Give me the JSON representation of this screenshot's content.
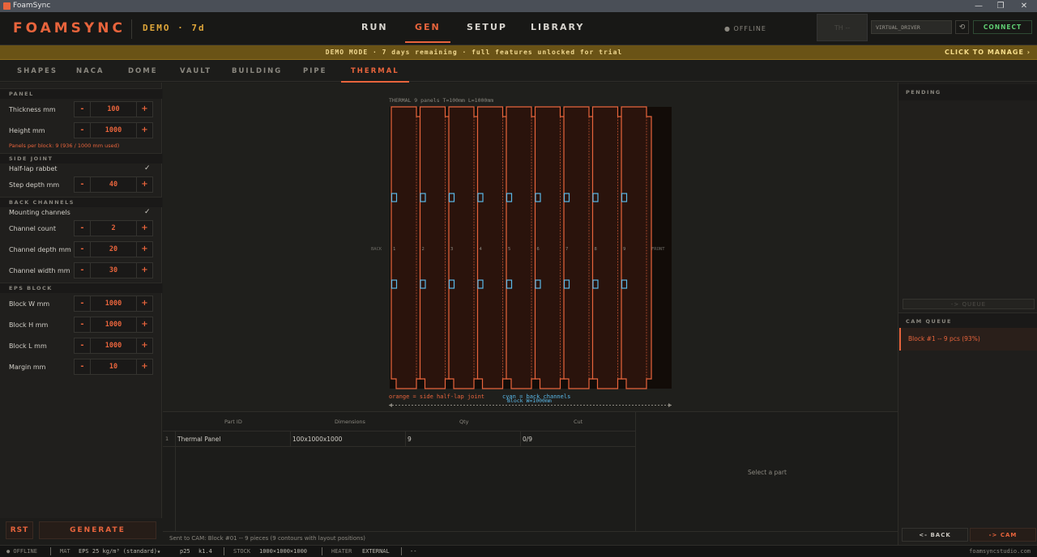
{
  "window": {
    "title": "FoamSync",
    "controls": [
      "—",
      "❐",
      "✕"
    ]
  },
  "header": {
    "brand": "FOAMSYNC",
    "demo_label": "DEMO · 7d",
    "nav": [
      "RUN",
      "GEN",
      "SETUP",
      "LIBRARY"
    ],
    "active_nav": "GEN",
    "status": "● OFFLINE",
    "driver_placeholder": "TH --",
    "driver_name": "VIRTUAL_DRIVER",
    "refresh_icon": "⟲",
    "connect_label": "CONNECT"
  },
  "banner": {
    "text": "DEMO MODE · 7 days remaining · full features unlocked for trial",
    "action": "CLICK TO MANAGE ›"
  },
  "subtabs": [
    "SHAPES",
    "NACA",
    "DOME",
    "VAULT",
    "BUILDING",
    "PIPE",
    "THERMAL"
  ],
  "active_subtab": "THERMAL",
  "left": {
    "panel": {
      "title": "PANEL",
      "thickness_label": "Thickness mm",
      "thickness": "100",
      "height_label": "Height mm",
      "height": "1000",
      "per_block": "Panels per block: 9   (936 / 1000 mm used)"
    },
    "side_joint": {
      "title": "SIDE JOINT",
      "half_lap_label": "Half-lap rabbet",
      "half_lap_checked": true,
      "step_label": "Step depth mm",
      "step": "40"
    },
    "back_channels": {
      "title": "BACK CHANNELS",
      "mounting_label": "Mounting channels",
      "mounting_checked": true,
      "count_label": "Channel count",
      "count": "2",
      "depth_label": "Channel depth mm",
      "depth": "20",
      "width_label": "Channel width mm",
      "width": "30"
    },
    "eps_block": {
      "title": "EPS BLOCK",
      "w_label": "Block W mm",
      "w": "1000",
      "h_label": "Block H mm",
      "h": "1000",
      "l_label": "Block L mm",
      "l": "1000",
      "margin_label": "Margin mm",
      "margin": "10"
    },
    "minus": "-",
    "plus": "+",
    "check": "✓",
    "rst_label": "RST",
    "generate_label": "GENERATE"
  },
  "preview": {
    "header": "THERMAL  9 panels  T=100mm  L=1000mm",
    "left_side": "BACK",
    "right_side": "FRONT",
    "panel_numbers": [
      "1",
      "2",
      "3",
      "4",
      "5",
      "6",
      "7",
      "8",
      "9"
    ],
    "panel_count": 9,
    "legend_orange": "orange = side half-lap joint",
    "legend_cyan": "cyan = back channels",
    "dim_label": "Block W=1000mm",
    "colors": {
      "orange": "#e8643c",
      "cyan": "#5ab8e8",
      "fill": "#2a130c",
      "block": "#120c08"
    }
  },
  "table": {
    "headers": [
      "Part ID",
      "Dimensions",
      "Qty",
      "Cut"
    ],
    "rows": [
      {
        "index": "1",
        "part": "Thermal Panel",
        "dims": "100x1000x1000",
        "qty": "9",
        "cut": "0/9"
      }
    ],
    "detail_placeholder": "Select a part"
  },
  "status_message": "Sent to CAM: Block #01 -- 9 pieces  (9 contours with layout positions)",
  "right": {
    "pending_title": "PENDING",
    "queue_label": "-> QUEUE",
    "cam_title": "CAM QUEUE",
    "cam_item": "Block #1 -- 9 pcs  (93%)",
    "back_label": "<- BACK",
    "cam_label": "-> CAM"
  },
  "statusbar": {
    "conn": "● OFFLINE",
    "mat_label": "MAT",
    "mat": "EPS 25 kg/m³ (standard)★",
    "p": "p25",
    "k": "k1.4",
    "stock_label": "STOCK",
    "stock": "1000×1000×1000",
    "heater_label": "HEATER",
    "heater": "EXTERNAL",
    "dash": "--",
    "url": "foamsyncstudio.com"
  }
}
